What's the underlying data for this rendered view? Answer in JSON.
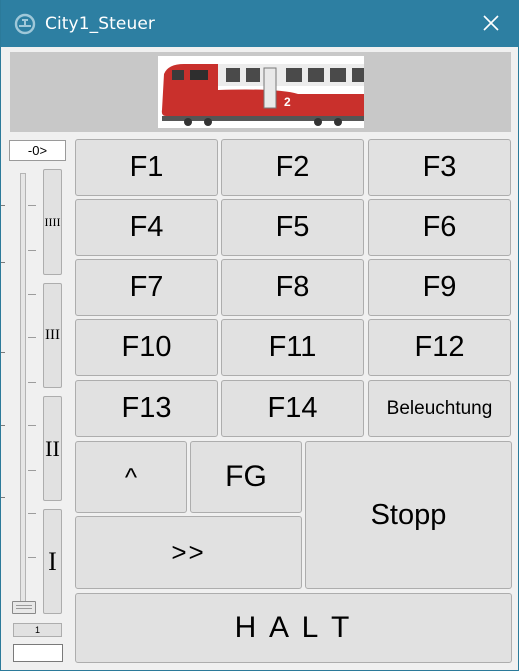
{
  "window": {
    "title": "City1_Steuer",
    "accent_color": "#2d7fa2",
    "icon": "locomotive-gauge-icon",
    "close_icon": "close-icon"
  },
  "locomotive_image": {
    "description_icon": "train-car-image",
    "body_color": "#c9302c",
    "stripe_color": "#ffffff",
    "digit": "2"
  },
  "speed_panel": {
    "direction": "-0>",
    "gears": [
      "IIII",
      "III",
      "II",
      "I"
    ],
    "slider_level": 0,
    "speed_value": "1",
    "speed_input_value": ""
  },
  "function_buttons": [
    "F1",
    "F2",
    "F3",
    "F4",
    "F5",
    "F6",
    "F7",
    "F8",
    "F9",
    "F10",
    "F11",
    "F12",
    "F13",
    "F14",
    "Beleuchtung"
  ],
  "controls": {
    "up": "^",
    "fg": "FG",
    "forward": ">>",
    "stop": "Stopp",
    "halt": "H A L T"
  }
}
